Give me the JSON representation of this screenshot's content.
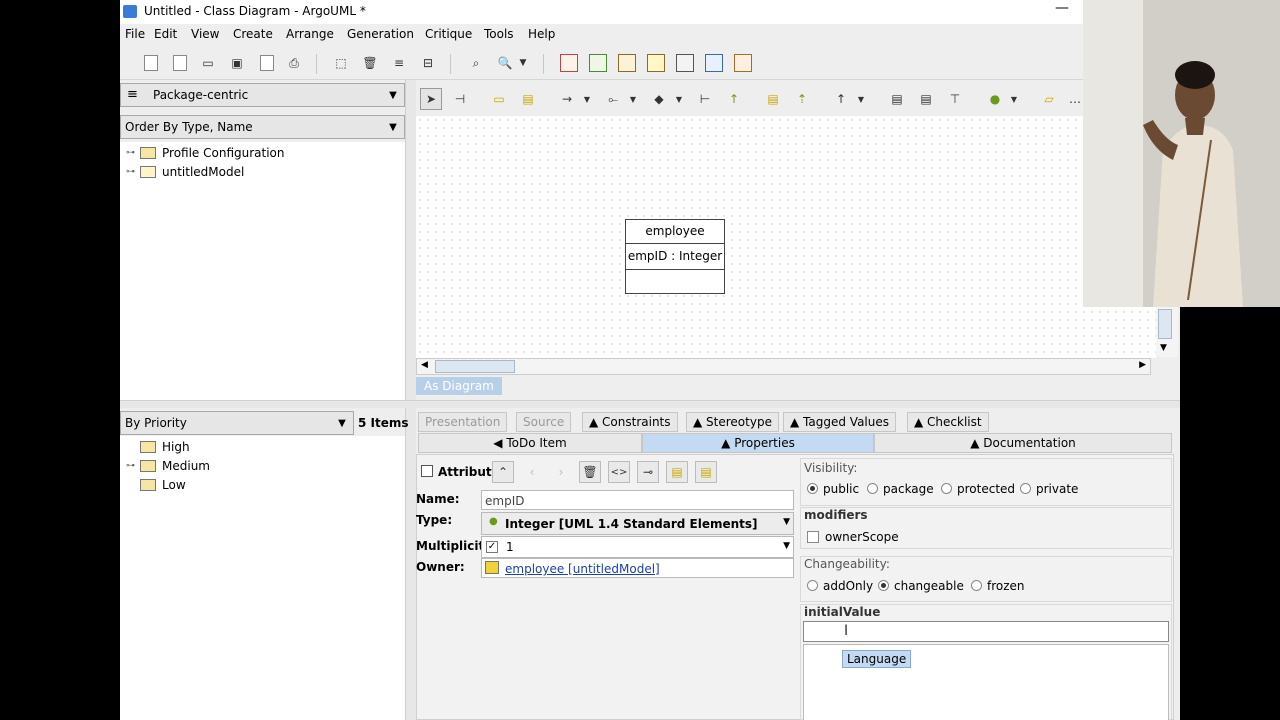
{
  "window": {
    "title": "Untitled - Class Diagram - ArgoUML *",
    "minimize_glyph": "—"
  },
  "menubar": {
    "items": [
      "File",
      "Edit",
      "View",
      "Create",
      "Arrange",
      "Generation",
      "Critique",
      "Tools",
      "Help"
    ]
  },
  "explorer": {
    "perspective": "Package-centric",
    "order": "Order By Type, Name",
    "tree": [
      "Profile Configuration",
      "untitledModel"
    ]
  },
  "todo": {
    "group_by": "By Priority",
    "count_label": "5 Items",
    "items": [
      "High",
      "Medium",
      "Low"
    ]
  },
  "diagram": {
    "class_name": "employee",
    "attribute": "empID : Integer",
    "tab_label": "As Diagram"
  },
  "detail_tabs": {
    "row1": [
      "Presentation",
      "Source",
      "▲ Constraints",
      "▲ Stereotype",
      "▲ Tagged Values",
      "▲ Checklist"
    ],
    "row2": [
      "◀ ToDo Item",
      "▲ Properties",
      "▲ Documentation"
    ]
  },
  "properties": {
    "header": "Attribute",
    "name_label": "Name:",
    "name_value": "empID",
    "type_label": "Type:",
    "type_value": "Integer [UML 1.4 Standard Elements]",
    "multiplicity_label": "Multiplicity:",
    "multiplicity_value": "1",
    "owner_label": "Owner:",
    "owner_value": "employee [untitledModel]",
    "visibility_label": "Visibility:",
    "visibility_options": [
      "public",
      "package",
      "protected",
      "private"
    ],
    "visibility_selected": "public",
    "modifiers_label": "modifiers",
    "owner_scope_label": "ownerScope",
    "changeability_label": "Changeability:",
    "changeability_options": [
      "addOnly",
      "changeable",
      "frozen"
    ],
    "changeability_selected": "changeable",
    "initial_value_label": "initialValue",
    "language_button": "Language"
  },
  "colors": {
    "selected_tab": "#c4daf2",
    "link": "#1a3fb0",
    "folder": "#f5e7a3",
    "class_icon": "#f2d23a"
  }
}
